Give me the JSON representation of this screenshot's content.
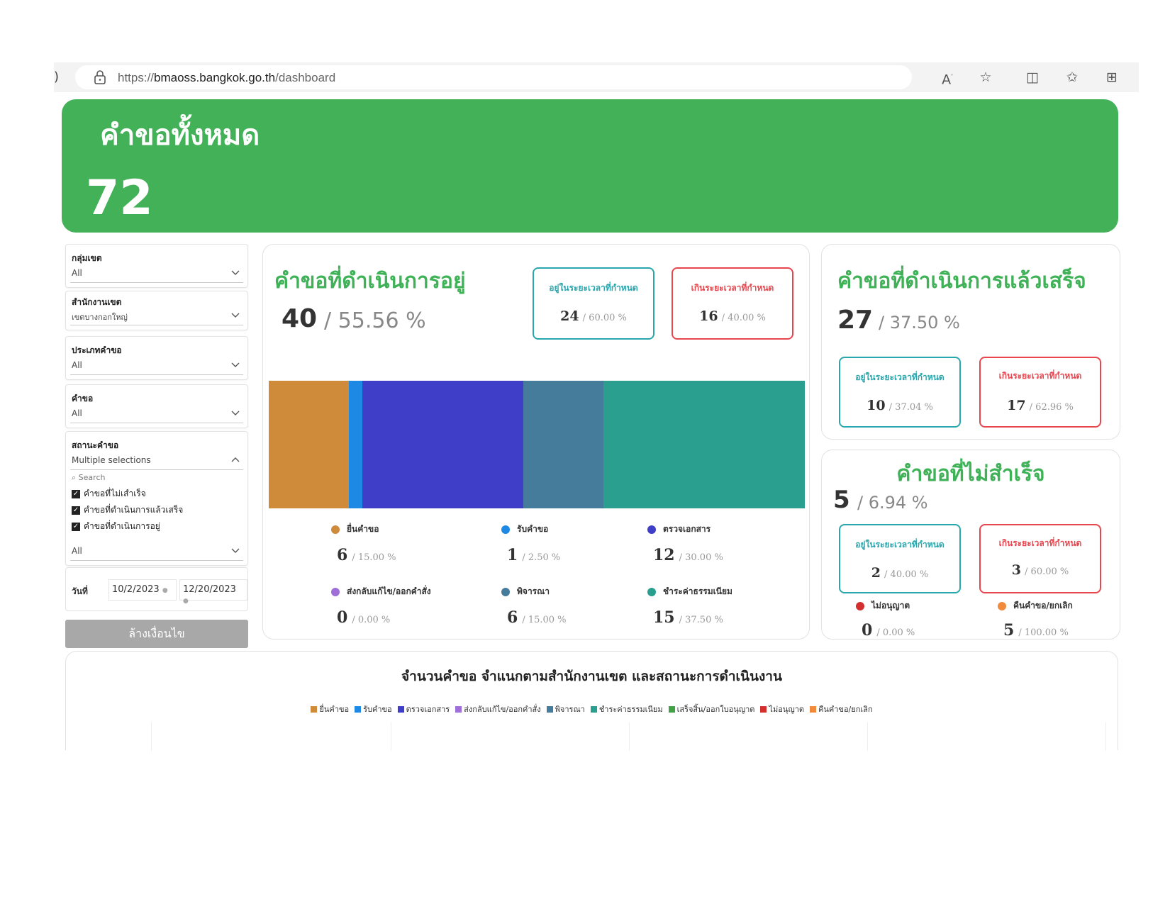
{
  "browser": {
    "url_prefix": "https://",
    "url_host": "bmaoss.bangkok.go.th",
    "url_path": "/dashboard"
  },
  "hero": {
    "title": "คำขอทั้งหมด",
    "value": "72"
  },
  "filters": {
    "district_group": {
      "label": "กลุ่มเขต",
      "value": "All"
    },
    "district_office": {
      "label": "สำนักงานเขต",
      "value": "เขตบางกอกใหญ่"
    },
    "request_category": {
      "label": "ประเภทคำขอ",
      "value": "All"
    },
    "request": {
      "label": "คำขอ",
      "value": "All"
    },
    "status": {
      "label": "สถานะคำขอ",
      "value": "Multiple selections",
      "search_placeholder": "Search",
      "options": [
        "คำขอที่ไม่เสำเร็จ",
        "คำขอที่ดำเนินการแล้วเสร็จ",
        "คำขอที่ดำเนินการอยู่"
      ],
      "next_value": "All"
    },
    "date": {
      "label": "วันที่",
      "from": "10/2/2023",
      "to": "12/20/2023"
    },
    "clear_label": "ล้างเงื่อนไข"
  },
  "in_progress": {
    "title": "คำขอที่ดำเนินการอยู่",
    "count": "40",
    "percent": "/ 55.56 %",
    "within": {
      "label": "อยู่ในระยะเวลาที่กำหนด",
      "count": "24",
      "percent": "/ 60.00 %"
    },
    "over": {
      "label": "เกินระยะเวลาที่กำหนด",
      "count": "16",
      "percent": "/ 40.00 %"
    },
    "legend": [
      {
        "label": "ยื่นคำขอ",
        "count": "6",
        "percent": "/ 15.00 %",
        "color": "#cf8a3a"
      },
      {
        "label": "รับคำขอ",
        "count": "1",
        "percent": "/ 2.50 %",
        "color": "#1e88e5"
      },
      {
        "label": "ตรวจเอกสาร",
        "count": "12",
        "percent": "/ 30.00 %",
        "color": "#3e3ec8"
      },
      {
        "label": "ส่งกลับแก้ไข/ออกคำสั่ง",
        "count": "0",
        "percent": "/ 0.00 %",
        "color": "#a06ed8"
      },
      {
        "label": "พิจารณา",
        "count": "6",
        "percent": "/ 15.00 %",
        "color": "#457c9c"
      },
      {
        "label": "ชำระค่าธรรมเนียม",
        "count": "15",
        "percent": "/ 37.50 %",
        "color": "#2a9e8f"
      }
    ]
  },
  "completed": {
    "title": "คำขอที่ดำเนินการแล้วเสร็จ",
    "count": "27",
    "percent": "/ 37.50 %",
    "within": {
      "label": "อยู่ในระยะเวลาที่กำหนด",
      "count": "10",
      "percent": "/ 37.04 %"
    },
    "over": {
      "label": "เกินระยะเวลาที่กำหนด",
      "count": "17",
      "percent": "/ 62.96 %"
    }
  },
  "failed": {
    "title": "คำขอที่ไม่สำเร็จ",
    "count": "5",
    "percent": "/ 6.94 %",
    "within": {
      "label": "อยู่ในระยะเวลาที่กำหนด",
      "count": "2",
      "percent": "/ 40.00 %"
    },
    "over": {
      "label": "เกินระยะเวลาที่กำหนด",
      "count": "3",
      "percent": "/ 60.00 %"
    },
    "legend": [
      {
        "label": "ไม่อนุญาต",
        "count": "0",
        "percent": "/ 0.00 %",
        "color": "#d32f2f"
      },
      {
        "label": "คืนคำขอ/ยกเลิก",
        "count": "5",
        "percent": "/ 100.00 %",
        "color": "#f08a3c"
      }
    ]
  },
  "bottom_chart": {
    "title": "จำนวนคำขอ  จำแนกตามสำนักงานเขต และสถานะการดำเนินงาน",
    "legend": [
      {
        "label": "ยื่นคำขอ",
        "color": "#cf8a3a"
      },
      {
        "label": "รับคำขอ",
        "color": "#1e88e5"
      },
      {
        "label": "ตรวจเอกสาร",
        "color": "#3e3ec8"
      },
      {
        "label": "ส่งกลับแก้ไข/ออกคำสั่ง",
        "color": "#a06ed8"
      },
      {
        "label": "พิจารณา",
        "color": "#457c9c"
      },
      {
        "label": "ชำระค่าธรรมเนียม",
        "color": "#2a9e8f"
      },
      {
        "label": "เสร็จสิ้น/ออกใบอนุญาต",
        "color": "#43a047"
      },
      {
        "label": "ไม่อนุญาต",
        "color": "#d32f2f"
      },
      {
        "label": "คืนคำขอ/ยกเลิก",
        "color": "#f08a3c"
      }
    ]
  }
}
